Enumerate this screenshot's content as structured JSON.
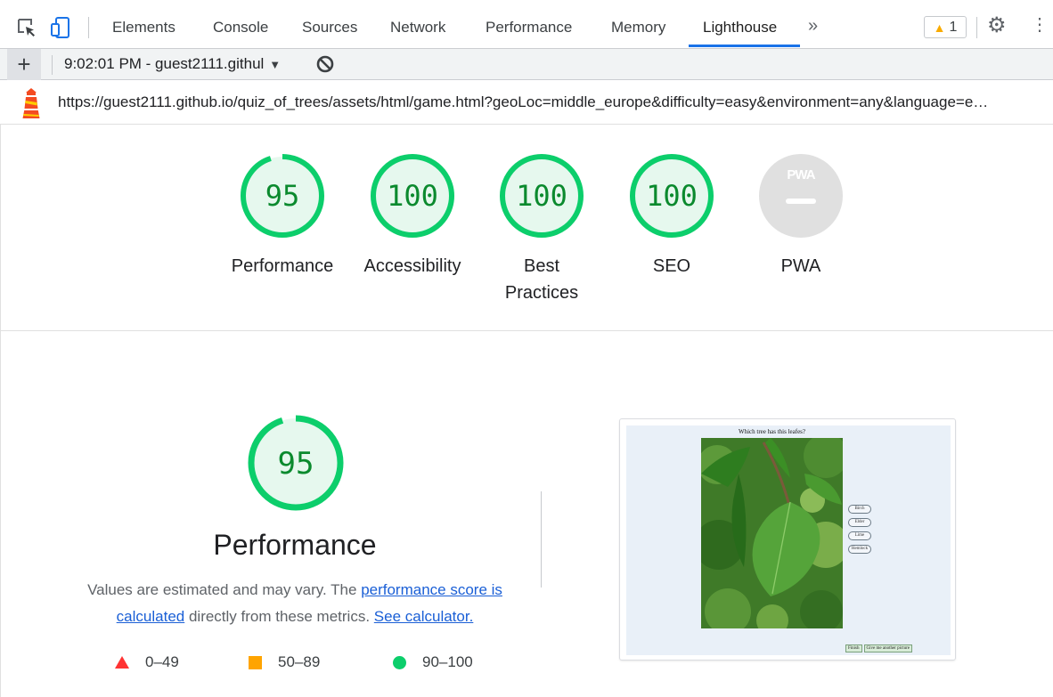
{
  "devtools": {
    "tabs": [
      "Elements",
      "Console",
      "Sources",
      "Network",
      "Performance",
      "Memory",
      "Lighthouse"
    ],
    "active_tab": "Lighthouse",
    "more_tabs_label": "»",
    "warning_count": "1",
    "accent_color": "#1a73e8"
  },
  "toolbar": {
    "add_label": "+",
    "report_label": "9:02:01 PM - guest2111.githul"
  },
  "url": {
    "text": "https://guest2111.github.io/quiz_of_trees/assets/html/game.html?geoLoc=middle_europe&difficulty=easy&environment=any&language=e…"
  },
  "scores": [
    {
      "label": "Performance",
      "score": "95",
      "value": 95
    },
    {
      "label": "Accessibility",
      "score": "100",
      "value": 100
    },
    {
      "label": "Best Practices",
      "score": "100",
      "value": 100
    },
    {
      "label": "SEO",
      "score": "100",
      "value": 100
    },
    {
      "label": "PWA",
      "score": "",
      "value": null,
      "badge_text": "PWA"
    }
  ],
  "colors": {
    "pass": "#0cce6b",
    "pass_text": "#0b8a2e",
    "pass_fill": "#e6f8ee",
    "average": "#ffa400",
    "fail": "#ff3333",
    "na": "#e0e0e0"
  },
  "performance": {
    "score": "95",
    "value": 95,
    "title": "Performance",
    "desc_prefix": "Values are estimated and may vary. The ",
    "desc_link1": "performance score is calculated",
    "desc_middle": " directly from these metrics. ",
    "desc_link2": "See calculator."
  },
  "legend": [
    {
      "range": "0–49",
      "shape": "triangle",
      "color": "#ff3333"
    },
    {
      "range": "50–89",
      "shape": "square",
      "color": "#ffa400"
    },
    {
      "range": "90–100",
      "shape": "circle",
      "color": "#0cce6b"
    }
  ],
  "screenshot": {
    "question": "Which tree has this leafes?",
    "options": [
      "Birch",
      "Elder",
      "Lime",
      "Hemlock"
    ],
    "buttons": [
      "Finish",
      "Give me another picture"
    ]
  }
}
